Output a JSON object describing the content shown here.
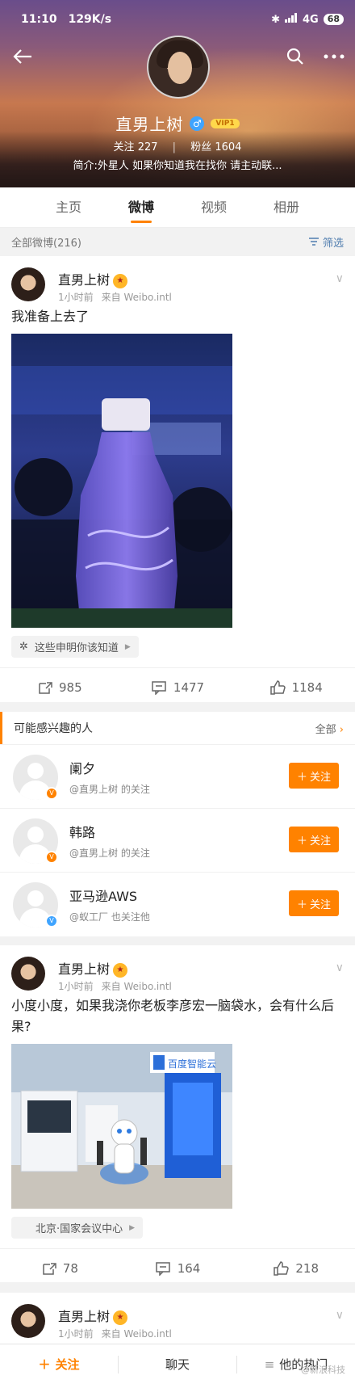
{
  "status_bar": {
    "time": "11:10",
    "speed": "129K/s",
    "network": "4G",
    "battery": "68"
  },
  "profile": {
    "name": "直男上树",
    "vip": "VIP1",
    "following_label": "关注",
    "following": "227",
    "fans_label": "粉丝",
    "fans": "1604",
    "bio": "简介:外星人 如果你知道我在找你 请主动联..."
  },
  "tabs": [
    {
      "label": "主页",
      "active": false
    },
    {
      "label": "微博",
      "active": true
    },
    {
      "label": "视频",
      "active": false
    },
    {
      "label": "相册",
      "active": false
    }
  ],
  "filter": {
    "all_label": "全部微博(216)",
    "filter_label": "筛选"
  },
  "posts": [
    {
      "author": "直男上树",
      "time": "1小时前",
      "source": "来自 Weibo.intl",
      "text": "我准备上去了",
      "chip": "这些申明你该知道",
      "reposts": "985",
      "comments": "1477",
      "likes": "1184"
    },
    {
      "author": "直男上树",
      "time": "1小时前",
      "source": "来自 Weibo.intl",
      "text": "小度小度，如果我浇你老板李彦宏一脑袋水，会有什么后果?",
      "image_sign": "百度智能云",
      "chip": "北京·国家会议中心",
      "reposts": "78",
      "comments": "164",
      "likes": "218"
    },
    {
      "author": "直男上树",
      "time": "1小时前",
      "source": "来自 Weibo.intl"
    }
  ],
  "suggest": {
    "title": "可能感兴趣的人",
    "all_label": "全部",
    "follow_label": "关注",
    "items": [
      {
        "name": "阑夕",
        "sub": "@直男上树 的关注",
        "badge_color": "#ff8200"
      },
      {
        "name": "韩路",
        "sub": "@直男上树 的关注",
        "badge_color": "#ff8200"
      },
      {
        "name": "亚马逊AWS",
        "sub": "@蚁工厂 也关注他",
        "badge_color": "#3fa4ff"
      }
    ]
  },
  "bottom_bar": {
    "follow": "关注",
    "chat": "聊天",
    "hot": "他的热门"
  },
  "watermark": "@新浪科技"
}
